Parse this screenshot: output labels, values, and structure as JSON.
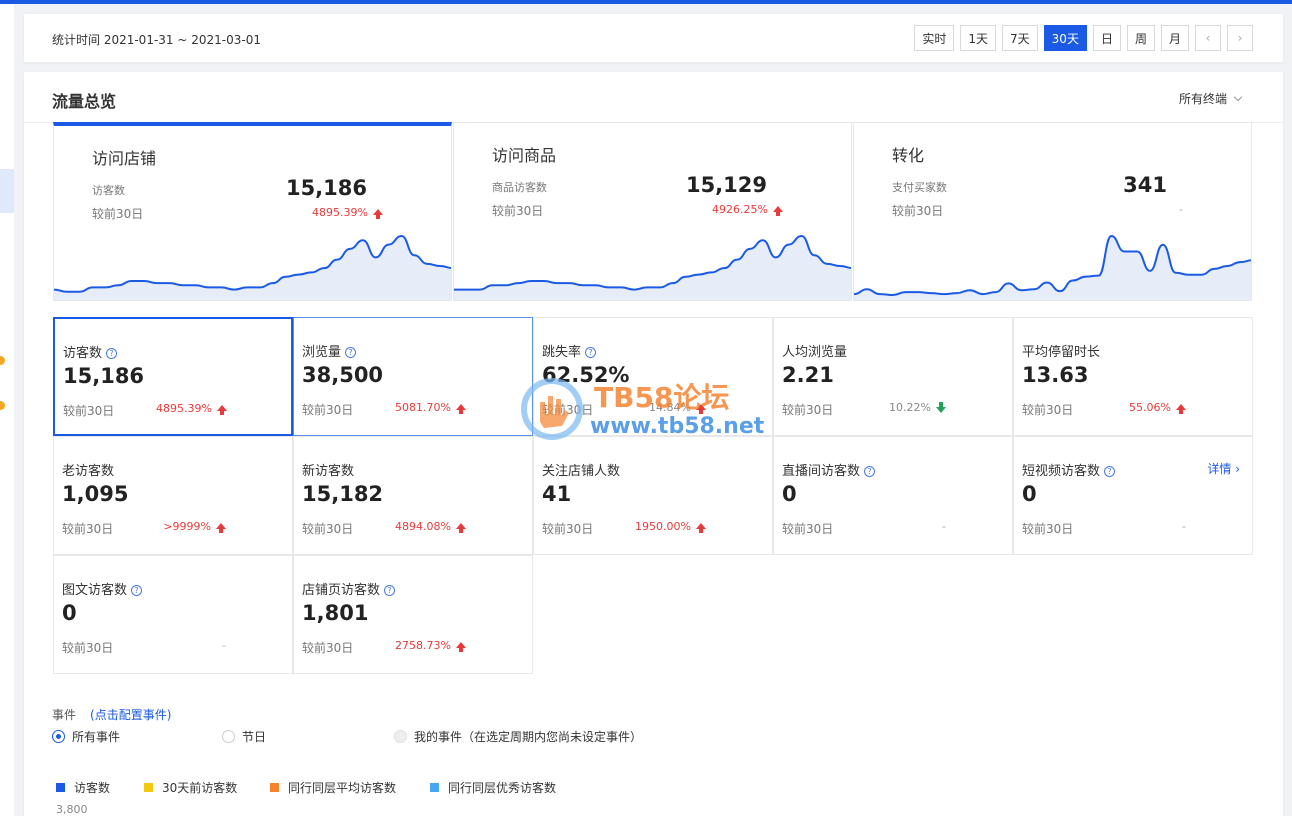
{
  "time": {
    "range": "统计时间 2021-01-31 ~ 2021-03-01",
    "buttons": [
      "实时",
      "1天",
      "7天",
      "30天",
      "日",
      "周",
      "月"
    ],
    "active": "30天"
  },
  "overview": {
    "title": "流量总览",
    "terminal": "所有终端",
    "cards": [
      {
        "title": "访问店铺",
        "metric": "访客数",
        "value": "15,186",
        "compare": "较前30日",
        "change": "4895.39%",
        "trend": "up",
        "series": [
          3,
          2,
          2,
          4,
          4,
          5,
          7,
          7,
          6,
          6,
          5,
          5,
          4,
          4,
          3,
          4,
          4,
          6,
          9,
          10,
          11,
          13,
          17,
          22,
          26,
          18,
          24,
          28,
          19,
          15,
          14,
          13
        ]
      },
      {
        "title": "访问商品",
        "metric": "商品访客数",
        "value": "15,129",
        "compare": "较前30日",
        "change": "4926.25%",
        "trend": "up",
        "series": [
          3,
          3,
          3,
          5,
          5,
          6,
          7,
          7,
          6,
          6,
          5,
          5,
          4,
          4,
          3,
          4,
          4,
          6,
          9,
          10,
          11,
          13,
          17,
          22,
          26,
          18,
          24,
          28,
          19,
          15,
          14,
          13
        ]
      },
      {
        "title": "转化",
        "metric": "支付买家数",
        "value": "341",
        "compare": "较前30日",
        "change": "-",
        "trend": "none",
        "series": [
          2,
          7,
          2,
          1,
          4,
          4,
          3,
          2,
          3,
          6,
          2,
          4,
          13,
          6,
          7,
          14,
          5,
          16,
          20,
          21,
          62,
          46,
          46,
          26,
          53,
          24,
          22,
          22,
          28,
          31,
          35,
          37
        ]
      }
    ]
  },
  "metrics": [
    {
      "label": "访客数",
      "help": true,
      "value": "15,186",
      "compare": "较前30日",
      "change": "4895.39%",
      "trend": "up"
    },
    {
      "label": "浏览量",
      "help": true,
      "value": "38,500",
      "compare": "较前30日",
      "change": "5081.70%",
      "trend": "up"
    },
    {
      "label": "跳失率",
      "help": true,
      "value": "62.52%",
      "compare": "较前30日",
      "change": "14.84%",
      "trend": "up-gray"
    },
    {
      "label": "人均浏览量",
      "help": false,
      "value": "2.21",
      "compare": "较前30日",
      "change": "10.22%",
      "trend": "down"
    },
    {
      "label": "平均停留时长",
      "help": false,
      "value": "13.63",
      "compare": "较前30日",
      "change": "55.06%",
      "trend": "up"
    },
    {
      "label": "老访客数",
      "help": false,
      "value": "1,095",
      "compare": "较前30日",
      "change": ">9999%",
      "trend": "up"
    },
    {
      "label": "新访客数",
      "help": false,
      "value": "15,182",
      "compare": "较前30日",
      "change": "4894.08%",
      "trend": "up"
    },
    {
      "label": "关注店铺人数",
      "help": false,
      "value": "41",
      "compare": "较前30日",
      "change": "1950.00%",
      "trend": "up"
    },
    {
      "label": "直播间访客数",
      "help": true,
      "value": "0",
      "compare": "较前30日",
      "change": "-",
      "trend": "none"
    },
    {
      "label": "短视频访客数",
      "help": true,
      "value": "0",
      "compare": "较前30日",
      "change": "-",
      "trend": "none",
      "more": "详情"
    },
    {
      "label": "图文访客数",
      "help": true,
      "value": "0",
      "compare": "较前30日",
      "change": "-",
      "trend": "none"
    },
    {
      "label": "店铺页访客数",
      "help": true,
      "value": "1,801",
      "compare": "较前30日",
      "change": "2758.73%",
      "trend": "up"
    }
  ],
  "events": {
    "label": "事件",
    "config_link": "(点击配置事件)",
    "options": [
      "所有事件",
      "节日",
      "我的事件（在选定周期内您尚未设定事件）"
    ],
    "selected": 0
  },
  "legend": [
    {
      "name": "访客数",
      "color": "#1a5ae5"
    },
    {
      "name": "30天前访客数",
      "color": "#f2c811"
    },
    {
      "name": "同行同层平均访客数",
      "color": "#f5832b"
    },
    {
      "name": "同行同层优秀访客数",
      "color": "#48a6f0"
    }
  ],
  "chart_y_top": "3,800",
  "watermark": {
    "line1": "TB58论坛",
    "line2": "www.tb58.net"
  },
  "colors": {
    "accent": "#1a5ae5",
    "up": "#e83a3a",
    "down": "#22a35a"
  }
}
